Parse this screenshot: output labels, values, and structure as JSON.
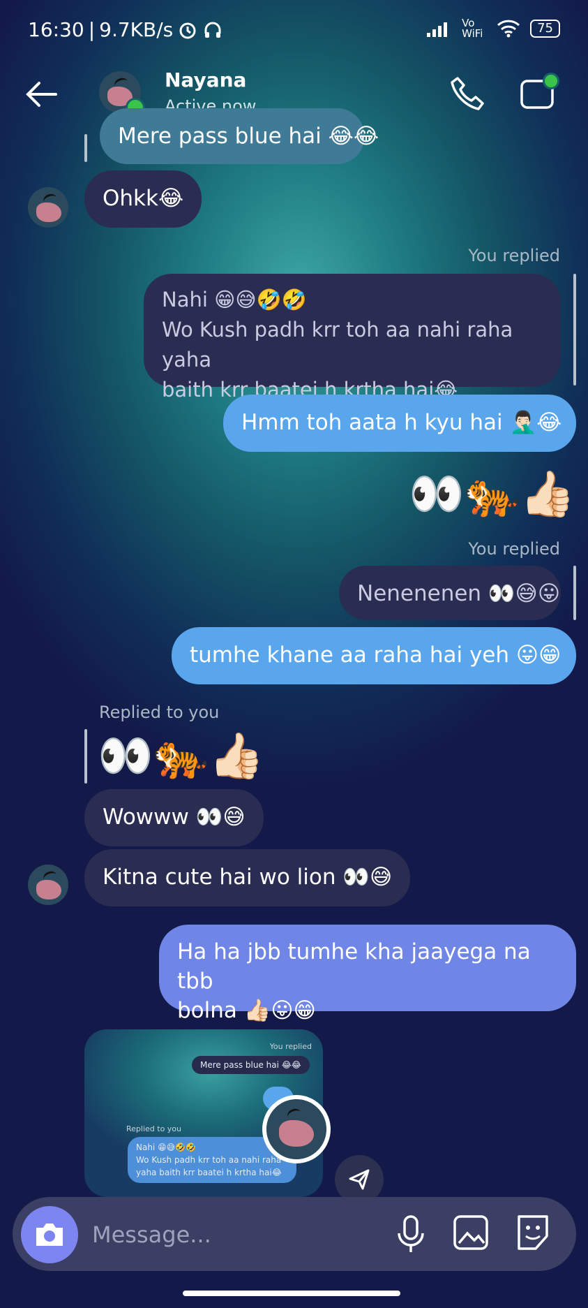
{
  "status_bar": {
    "time": "16:30",
    "speed": "9.7KB/s",
    "network": "Vo WiFi",
    "battery": "75"
  },
  "header": {
    "name": "Nayana",
    "status": "Active now"
  },
  "messages": {
    "m0": "Mere pass blue hai 😂😂",
    "m1": "Ohkk😂",
    "label_you_replied_1": "You replied",
    "m2_line1": "Nahi 😁😅🤣🤣",
    "m2_line2": "Wo Kush padh krr toh aa nahi raha yaha",
    "m2_line3": "baith krr baatei h krtha hai😂",
    "m3": "Hmm toh aata h kyu hai 🤦🏻‍♂️😂",
    "m4": "👀🐅👍🏻",
    "label_you_replied_2": "You replied",
    "m5": "Nenenenen 👀😅😛",
    "m6": "tumhe khane aa raha hai yeh 😛😁",
    "label_replied_to_you": "Replied to you",
    "m7": "👀🐅👍🏻",
    "m8": "Wowww 👀😅",
    "m9": "Kitna cute hai wo lion 👀😅",
    "m10_line1": "Ha ha jbb tumhe kha jaayega na tbb",
    "m10_line2": "bolna 👍🏻😛😁"
  },
  "preview": {
    "you_replied": "You replied",
    "quoted": "Mere pass blue hai 😂😂",
    "replied_to_you": "Replied to you",
    "line1": "Nahi 😁😅🤣🤣",
    "line2": "Wo Kush padh krr toh aa nahi raha",
    "line3": "yaha baith krr baatei h krtha hai😂"
  },
  "composer": {
    "placeholder": "Message..."
  },
  "icons": [
    "back-arrow-icon",
    "phone-icon",
    "video-call-icon",
    "camera-icon",
    "microphone-icon",
    "gallery-icon",
    "sticker-icon",
    "share-icon"
  ]
}
